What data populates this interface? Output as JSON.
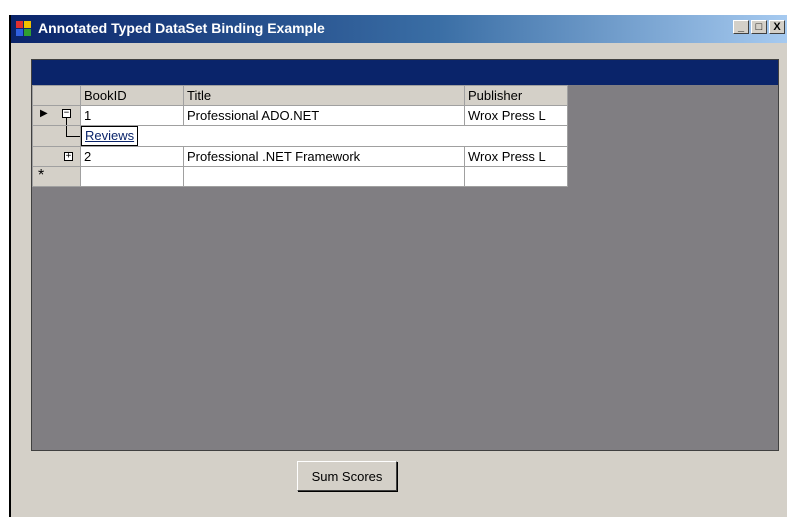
{
  "window": {
    "title": "Annotated Typed DataSet Binding Example",
    "controls": {
      "minimize": "_",
      "maximize": "□",
      "close": "X"
    }
  },
  "grid": {
    "headers": [
      "BookID",
      "Title",
      "Publisher"
    ],
    "rows": [
      {
        "id": "1",
        "title": "Professional ADO.NET",
        "publisher": "Wrox Press L",
        "expanded": true,
        "child_link": "Reviews"
      },
      {
        "id": "2",
        "title": "Professional .NET Framework",
        "publisher": "Wrox Press L",
        "expanded": false
      }
    ],
    "new_row_marker": "*",
    "current_row_marker": "▶"
  },
  "buttons": {
    "sum_scores": "Sum Scores"
  },
  "colors": {
    "title_start": "#0a246a",
    "caption_band": "#0a246a",
    "grid_background": "#807e82"
  }
}
